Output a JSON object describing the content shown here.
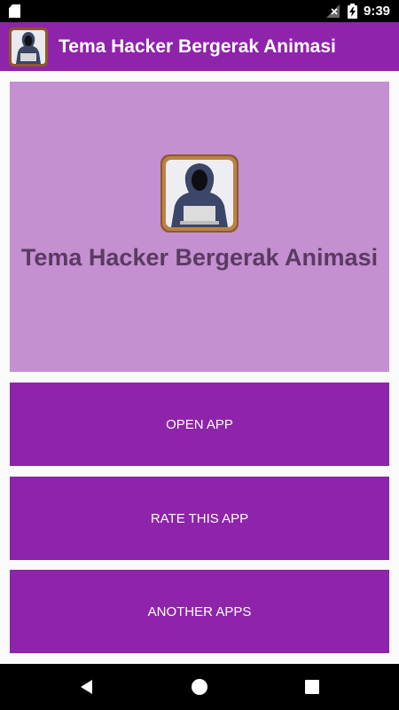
{
  "status_bar": {
    "time": "9:39",
    "icons": [
      "sd-card-icon",
      "signal-off-icon",
      "battery-charging-icon"
    ]
  },
  "app_bar": {
    "title": "Tema Hacker Bergerak Animasi",
    "icon": "hacker-hoodie-icon"
  },
  "hero": {
    "title": "Tema Hacker Bergerak Animasi",
    "icon": "hacker-hoodie-icon"
  },
  "actions": {
    "open_label": "OPEN APP",
    "rate_label": "RATE THIS APP",
    "more_label": "ANOTHER APPS"
  },
  "nav_bar": {
    "icons": [
      "back-icon",
      "home-icon",
      "recents-icon"
    ]
  },
  "colors": {
    "primary": "#8e24aa",
    "hero_bg": "#c490d1",
    "hero_text": "#5b3a63",
    "page_bg": "#fafafa"
  }
}
